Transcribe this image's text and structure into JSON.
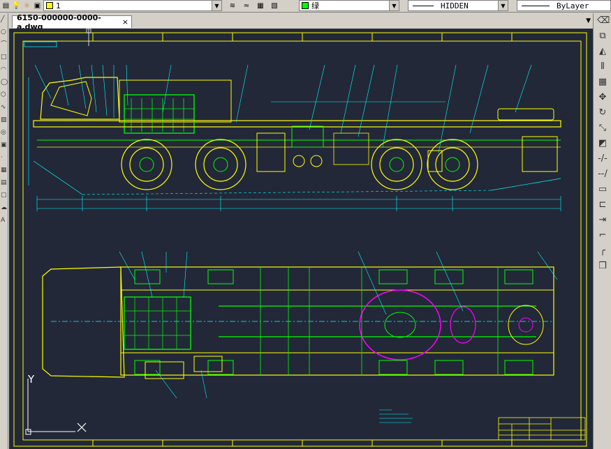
{
  "toolbar": {
    "layer_name": "1",
    "color_value": "绿",
    "linetype_value": "HIDDEN",
    "lineweight_value": "ByLayer",
    "colors": {
      "layer_swatch": "#ffff00",
      "color_swatch": "#00ff00"
    }
  },
  "document": {
    "tab_title": "6150-000000-0000-a.dwg",
    "tab_close": "×",
    "tab_menu": "▼"
  },
  "canvas": {
    "background": "#222838",
    "ucs": {
      "y_label": "Y",
      "x_label": "X"
    },
    "colors": {
      "frame": "#ffff00",
      "green": "#00ff00",
      "yellow": "#ffff00",
      "cyan": "#00ffff",
      "magenta": "#ff00ff",
      "white": "#ffffff"
    }
  },
  "icons": {
    "left": [
      "line-icon",
      "circle-icon",
      "polyline-icon",
      "rectangle-icon",
      "arc-icon",
      "ellipse-icon",
      "hatch-icon",
      "block-icon",
      "table-icon",
      "text-icon"
    ],
    "right": [
      "erase-icon",
      "copy-icon",
      "mirror-icon",
      "offset-icon",
      "array-icon",
      "move-icon",
      "rotate-icon",
      "scale-icon",
      "stretch-icon",
      "trim-icon",
      "extend-icon",
      "break-icon",
      "join-icon",
      "chamfer-icon",
      "fillet-icon",
      "explode-icon"
    ]
  }
}
